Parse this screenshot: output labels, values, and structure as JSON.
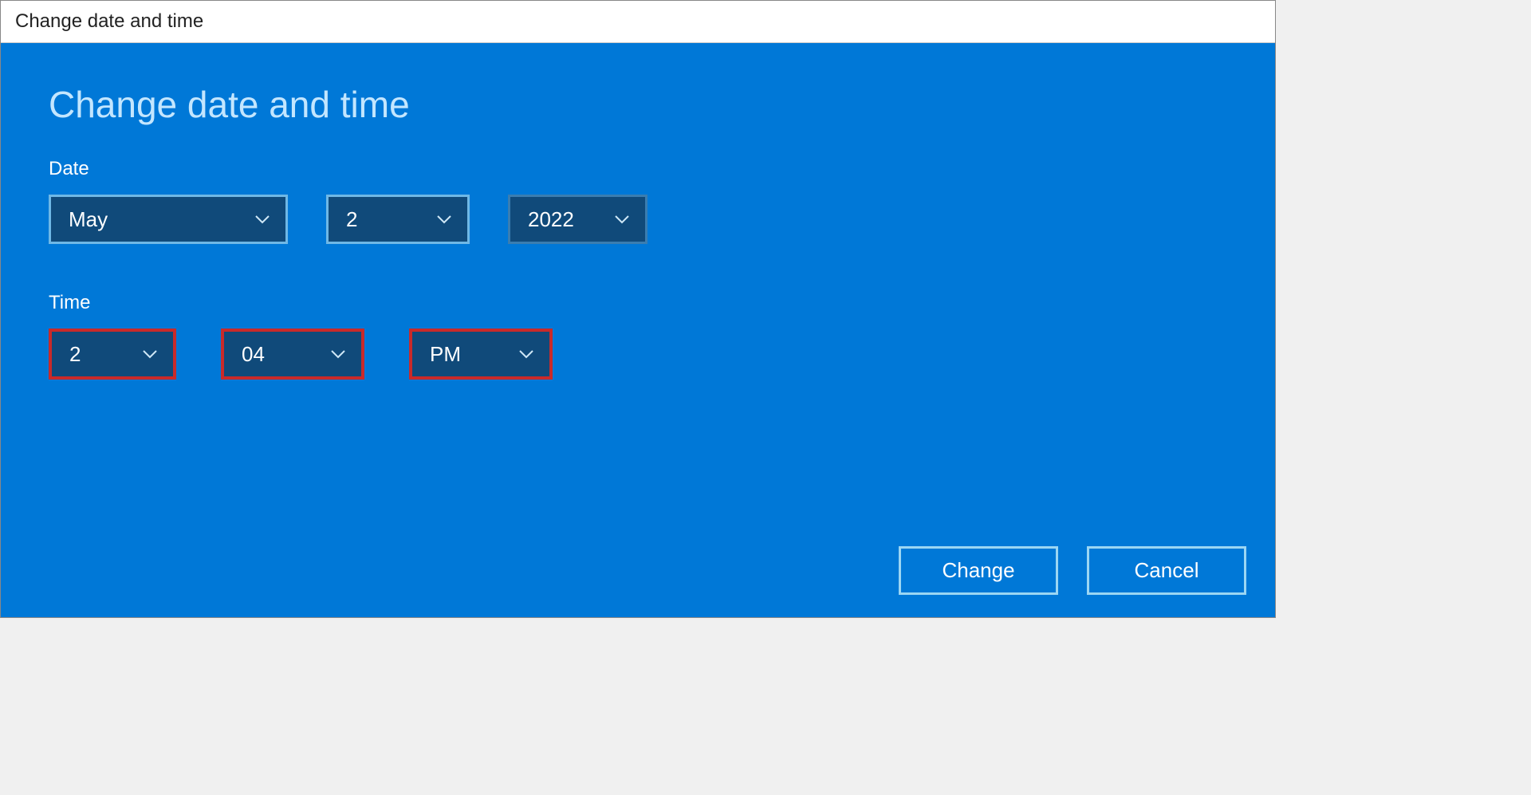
{
  "window": {
    "title": "Change date and time"
  },
  "dialog": {
    "heading": "Change date and time",
    "date_label": "Date",
    "time_label": "Time",
    "month_value": "May",
    "day_value": "2",
    "year_value": "2022",
    "hour_value": "2",
    "minute_value": "04",
    "ampm_value": "PM",
    "change_button": "Change",
    "cancel_button": "Cancel"
  }
}
